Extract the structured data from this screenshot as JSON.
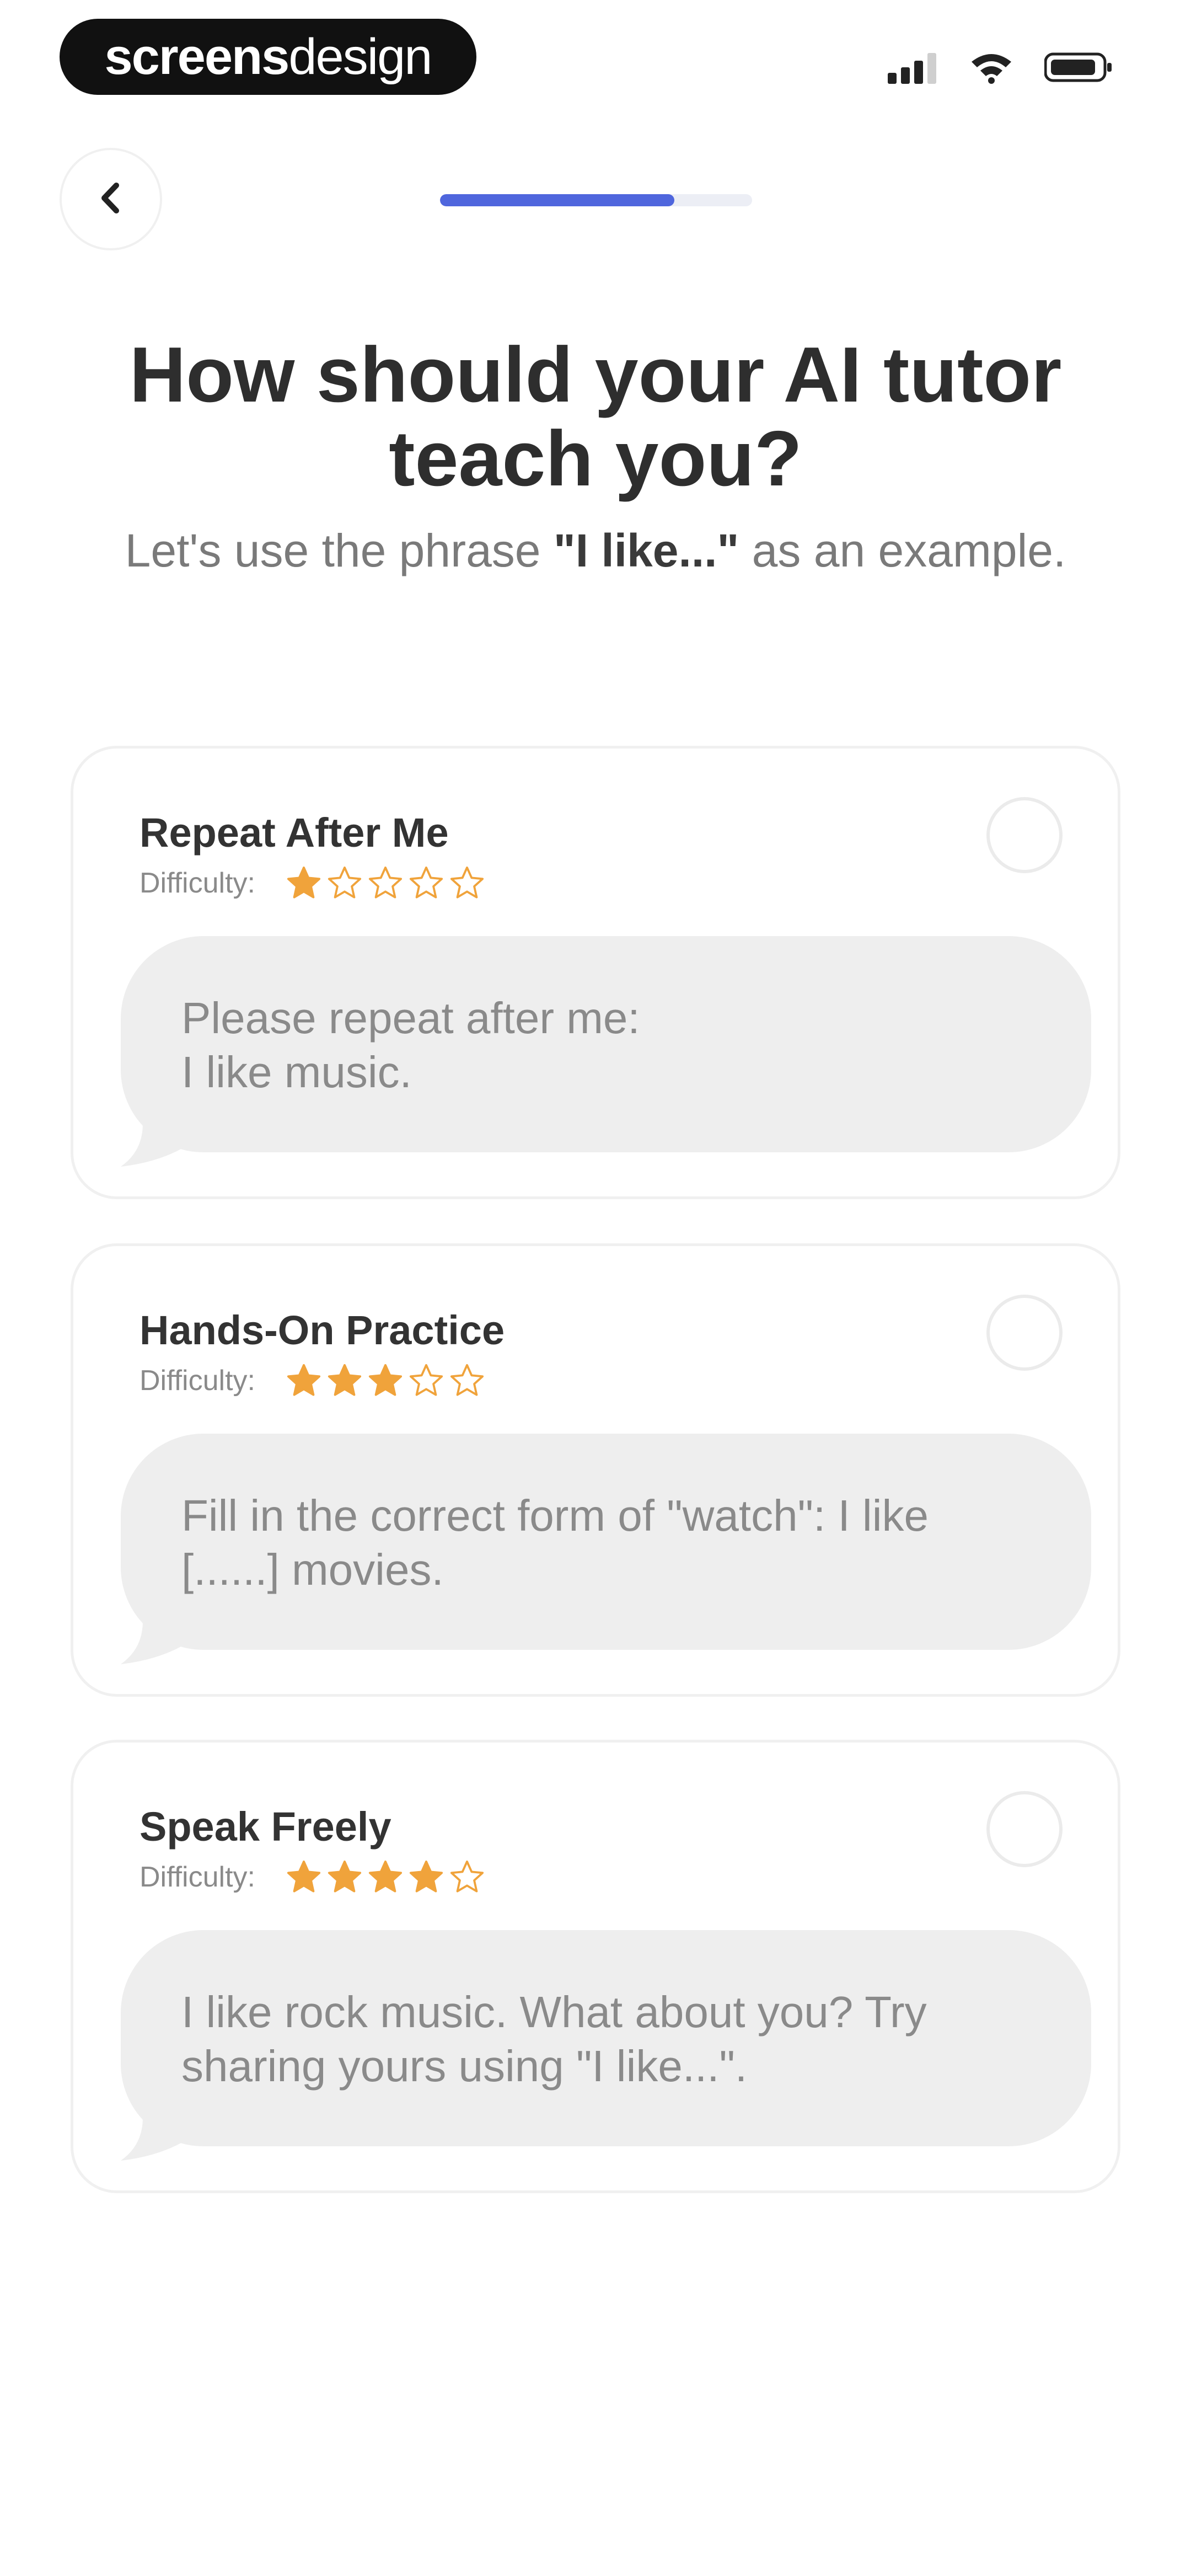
{
  "status_bar": {
    "brand_bold": "screens",
    "brand_light": "design"
  },
  "onboarding": {
    "progress": 0.75
  },
  "heading": {
    "title": "How should your AI tutor teach you?",
    "subtitle_prefix": "Let's use the phrase ",
    "subtitle_phrase": "\"I like...\"",
    "subtitle_suffix": " as an example."
  },
  "options": [
    {
      "title": "Repeat After Me",
      "difficulty_label": "Difficulty:",
      "difficulty_rating": 1,
      "example": "Please repeat after me:\nI like music.",
      "selected": false
    },
    {
      "title": "Hands-On Practice",
      "difficulty_label": "Difficulty:",
      "difficulty_rating": 3,
      "example": "Fill in the correct form of \"watch\": I like [......] movies.",
      "selected": false
    },
    {
      "title": "Speak Freely",
      "difficulty_label": "Difficulty:",
      "difficulty_rating": 4,
      "example": "I like rock music. What about you? Try sharing yours using \"I like...\".",
      "selected": false
    }
  ],
  "colors": {
    "accent": "#4f66dd",
    "star": "#f0a33b",
    "bubble": "#eeeeee"
  },
  "icons": {
    "back": "chevron-left-icon",
    "signal": "signal-icon",
    "wifi": "wifi-icon",
    "battery": "battery-icon",
    "star": "star-icon",
    "radio": "radio-unselected-icon"
  }
}
